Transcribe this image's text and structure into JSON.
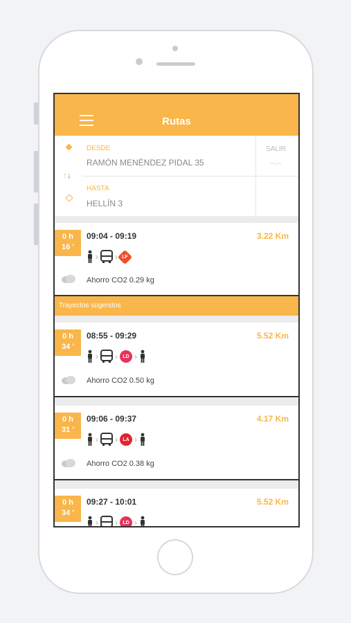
{
  "header": {
    "title": "Rutas"
  },
  "search": {
    "from_label": "DESDE",
    "from_value": "RAMÓN MENÉNDEZ PIDAL 35",
    "to_label": "HASTA",
    "to_value": "HELLÍN 3",
    "depart_label": "SALIR",
    "depart_value": "--:--"
  },
  "main_route": {
    "duration_h": "0 h",
    "duration_m": "16 '",
    "times": "09:04 - 09:19",
    "distance": "3.22 Km",
    "co2": "Ahorro CO2 0.29 kg",
    "line": {
      "label": "LF",
      "color": "#ef4d2a",
      "shape": "diamond"
    }
  },
  "section_title": "Trayectos sugeridos",
  "suggested": [
    {
      "duration_h": "0 h",
      "duration_m": "34 '",
      "times": "08:55 - 09:29",
      "distance": "5.52 Km",
      "co2": "Ahorro CO2 0.50 kg",
      "line": {
        "label": "LD",
        "color": "#e8335c"
      }
    },
    {
      "duration_h": "0 h",
      "duration_m": "31 '",
      "times": "09:06 - 09:37",
      "distance": "4.17 Km",
      "co2": "Ahorro CO2 0.38 kg",
      "line": {
        "label": "LA",
        "color": "#e0262f"
      }
    },
    {
      "duration_h": "0 h",
      "duration_m": "34 '",
      "times": "09:27 - 10:01",
      "distance": "5.52 Km",
      "co2": "",
      "line": {
        "label": "LD",
        "color": "#e8335c"
      }
    }
  ],
  "icons": {
    "walk": "walking-person-icon",
    "bus": "bus-icon",
    "cloud": "cloud-icon",
    "menu": "hamburger-icon",
    "swap": "swap-arrows-icon"
  },
  "colors": {
    "accent": "#f9b64a",
    "frame": "#333333"
  }
}
